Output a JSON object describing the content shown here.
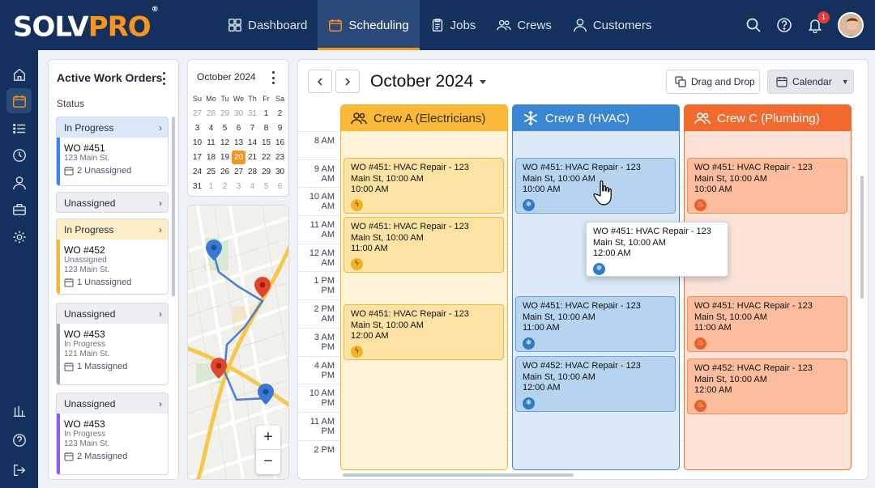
{
  "brand": {
    "solv": "SOLV",
    "pro": "PRO",
    "mark": "®"
  },
  "nav": [
    {
      "label": "Dashboard",
      "icon": "dashboard-icon"
    },
    {
      "label": "Scheduling",
      "icon": "calendar-icon",
      "active": true
    },
    {
      "label": "Jobs",
      "icon": "clipboard-icon"
    },
    {
      "label": "Crews",
      "icon": "users-icon"
    },
    {
      "label": "Customers",
      "icon": "user-icon"
    }
  ],
  "header": {
    "notification_count": "1"
  },
  "work_orders": {
    "title": "Active Work Orders",
    "status_label": "Status",
    "cards": [
      {
        "status": "In Progress",
        "wo": "WO #451",
        "lines": [
          "123 Main St."
        ],
        "assign": "2 Unassigned",
        "color": "#3b82f6"
      },
      {
        "status": "Unassigned",
        "collapsed": true,
        "color": "#9ca3af"
      },
      {
        "status": "In Progress",
        "wo": "WO #452",
        "lines": [
          "Unassigned",
          "123 Main St."
        ],
        "assign": "1 Unassigned",
        "color": "#f7b733"
      },
      {
        "status": "Unassigned",
        "wo": "WO #453",
        "lines": [
          "In Progress",
          "121 Main St."
        ],
        "assign": "1 Massigned",
        "color": "#9ca3af"
      },
      {
        "status": "Unassigned",
        "wo": "WO #453",
        "lines": [
          "In Progress",
          "123 Main St."
        ],
        "assign": "2 Massigned",
        "color": "#8b5cf6"
      }
    ]
  },
  "mini_calendar": {
    "title": "October 2024",
    "days": [
      "Su",
      "Mo",
      "Tu",
      "We",
      "Th",
      "Fr",
      "Sa"
    ],
    "weeks": [
      [
        "27",
        "28",
        "29",
        "30",
        "31",
        "1",
        "2"
      ],
      [
        "3",
        "4",
        "5",
        "6",
        "7",
        "8",
        "9"
      ],
      [
        "10",
        "11",
        "12",
        "13",
        "14",
        "15",
        "16"
      ],
      [
        "17",
        "18",
        "19",
        "20",
        "21",
        "22",
        "23"
      ],
      [
        "24",
        "25",
        "26",
        "27",
        "28",
        "29",
        "30"
      ],
      [
        "31",
        "1",
        "2",
        "3",
        "4",
        "5",
        "6"
      ]
    ],
    "dim": [
      [
        0,
        0
      ],
      [
        0,
        1
      ],
      [
        0,
        2
      ],
      [
        0,
        3
      ],
      [
        0,
        4
      ],
      [
        5,
        1
      ],
      [
        5,
        2
      ],
      [
        5,
        3
      ],
      [
        5,
        4
      ],
      [
        5,
        5
      ],
      [
        5,
        6
      ]
    ],
    "selected": [
      3,
      3
    ]
  },
  "map": {
    "zoom_in": "+",
    "zoom_out": "−"
  },
  "scheduler": {
    "title": "October 2024",
    "drag_label": "Drag and Drop",
    "view_label": "Calendar",
    "times": [
      "8 AM",
      "9 AM\nAM",
      "10 AM\nAM",
      "11 AM\nAM",
      "12 AM\nAM",
      "1 PM\nPM",
      "2 PM\nAM",
      "3 AM\nPM",
      "4 AM\nPM",
      "10 AM\nPM",
      "11 AM\nPM",
      "2 PM"
    ],
    "crews": [
      {
        "name": "Crew A (Electricians)",
        "icon": "users-icon",
        "header_bg": "#fbb93a",
        "body_bg": "#fef3d6",
        "border": "#f0b323",
        "text": "#3a2a00"
      },
      {
        "name": "Crew B (HVAC)",
        "icon": "snowflake-icon",
        "header_bg": "#3a86d3",
        "body_bg": "#dce9f7",
        "border": "#3a86d3",
        "text": "#ffffff"
      },
      {
        "name": "Crew C (Plumbing)",
        "icon": "users-icon",
        "header_bg": "#f26a2e",
        "body_bg": "#fde3d7",
        "border": "#f26a2e",
        "text": "#ffffff"
      }
    ],
    "events": [
      {
        "crew": "a",
        "line1": "WO #451: HVAC Repair - 123",
        "line2": "Main St, 10:00 AM",
        "line3": "10:00 AM",
        "icon": "bolt-icon"
      },
      {
        "crew": "a",
        "line1": "WO #451: HVAC Repair - 123",
        "line2": "Main St, 10:00 AM",
        "line3": "11:00 AM",
        "icon": "bolt-icon"
      },
      {
        "crew": "a",
        "line1": "WO #451: HVAC Repair - 123",
        "line2": "Main St, 10:00 AM",
        "line3": "12:00 AM",
        "icon": "bolt-icon"
      },
      {
        "crew": "b",
        "line1": "WO #451: HVAC Repair - 123",
        "line2": "Main St, 10:00 AM",
        "line3": "10:00 AM",
        "icon": "snowflake-icon"
      },
      {
        "crew": "b",
        "line1": "WO #451: HVAC Repair - 123",
        "line2": "Main St, 10:00 AM",
        "line3": "11:00 AM",
        "icon": "snowflake-icon"
      },
      {
        "crew": "b",
        "line1": "WO #452: HVAC Repair - 123",
        "line2": "Main St, 10:00 AM",
        "line3": "12:00 AM",
        "icon": "snowflake-icon"
      },
      {
        "crew": "c",
        "line1": "WO #451: HVAC Repair - 123",
        "line2": "Main St, 10:00 AM",
        "line3": "10:00 AM",
        "icon": "flame-icon"
      },
      {
        "crew": "c",
        "line1": "WO #451: HVAC Repair - 123",
        "line2": "Main St, 10:00 AM",
        "line3": "11:00 AM",
        "icon": "flame-icon"
      },
      {
        "crew": "c",
        "line1": "WO #452: HVAC Repair - 123",
        "line2": "Main St, 10:00 AM",
        "line3": "12:00 AM",
        "icon": "flame-icon"
      }
    ],
    "dragging": {
      "line1": "WO #451: HVAC Repair - 123",
      "line2": "Main St, 10:00 AM",
      "line3": "12:00 AM",
      "icon": "snowflake-icon"
    }
  }
}
